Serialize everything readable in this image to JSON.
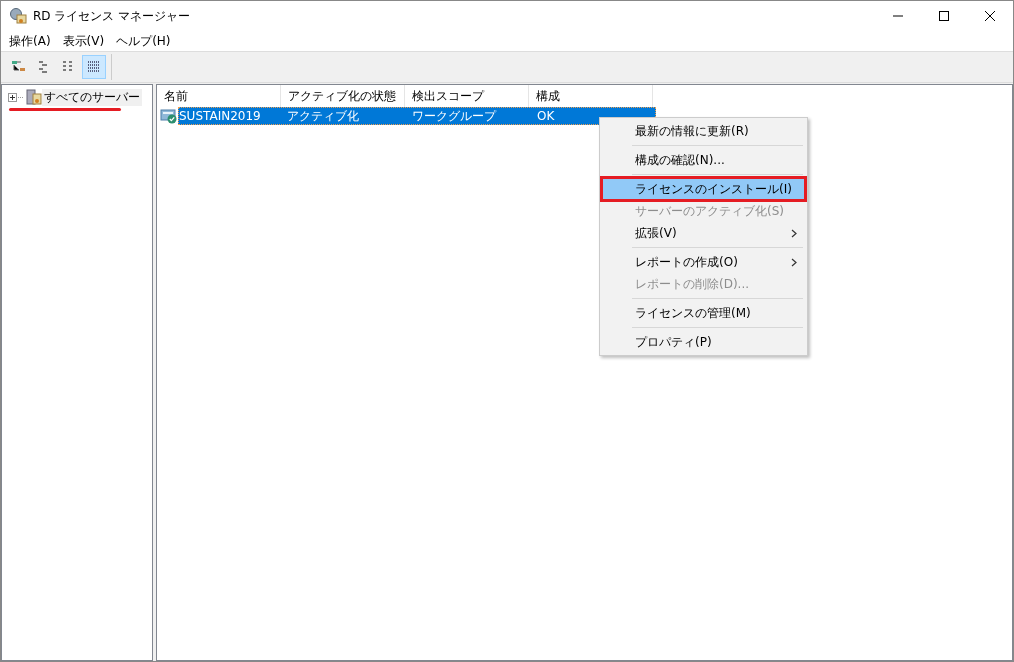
{
  "window": {
    "title": "RD ライセンス マネージャー"
  },
  "menu_bar": [
    "操作(A)",
    "表示(V)",
    "ヘルプ(H)"
  ],
  "toolbar": [
    {
      "selected": false
    },
    {
      "selected": false
    },
    {
      "selected": false
    },
    {
      "selected": true
    }
  ],
  "tree": {
    "items": [
      {
        "label": "すべてのサーバー",
        "expanded": false,
        "underlined": true
      }
    ]
  },
  "table": {
    "columns": [
      "名前",
      "アクティブ化の状態",
      "検出スコープ",
      "構成"
    ],
    "rows": [
      {
        "cells": [
          "SUSTAIN2019",
          "アクティブ化",
          "ワークグループ",
          "OK"
        ],
        "selected": true
      }
    ]
  },
  "context_menu": [
    {
      "kind": "item",
      "label": "最新の情報に更新(R)",
      "disabled": false,
      "submenu": false,
      "selected": false,
      "outlined": false
    },
    {
      "kind": "separator"
    },
    {
      "kind": "item",
      "label": "構成の確認(N)...",
      "disabled": false,
      "submenu": false,
      "selected": false,
      "outlined": false
    },
    {
      "kind": "separator"
    },
    {
      "kind": "item",
      "label": "ライセンスのインストール(I)",
      "disabled": false,
      "submenu": false,
      "selected": true,
      "outlined": true
    },
    {
      "kind": "item",
      "label": "サーバーのアクティブ化(S)",
      "disabled": true,
      "submenu": false,
      "selected": false,
      "outlined": false
    },
    {
      "kind": "item",
      "label": "拡張(V)",
      "disabled": false,
      "submenu": true,
      "selected": false,
      "outlined": false
    },
    {
      "kind": "separator"
    },
    {
      "kind": "item",
      "label": "レポートの作成(O)",
      "disabled": false,
      "submenu": true,
      "selected": false,
      "outlined": false
    },
    {
      "kind": "item",
      "label": "レポートの削除(D)...",
      "disabled": true,
      "submenu": false,
      "selected": false,
      "outlined": false
    },
    {
      "kind": "separator"
    },
    {
      "kind": "item",
      "label": "ライセンスの管理(M)",
      "disabled": false,
      "submenu": false,
      "selected": false,
      "outlined": false
    },
    {
      "kind": "separator"
    },
    {
      "kind": "item",
      "label": "プロパティ(P)",
      "disabled": false,
      "submenu": false,
      "selected": false,
      "outlined": false
    }
  ]
}
